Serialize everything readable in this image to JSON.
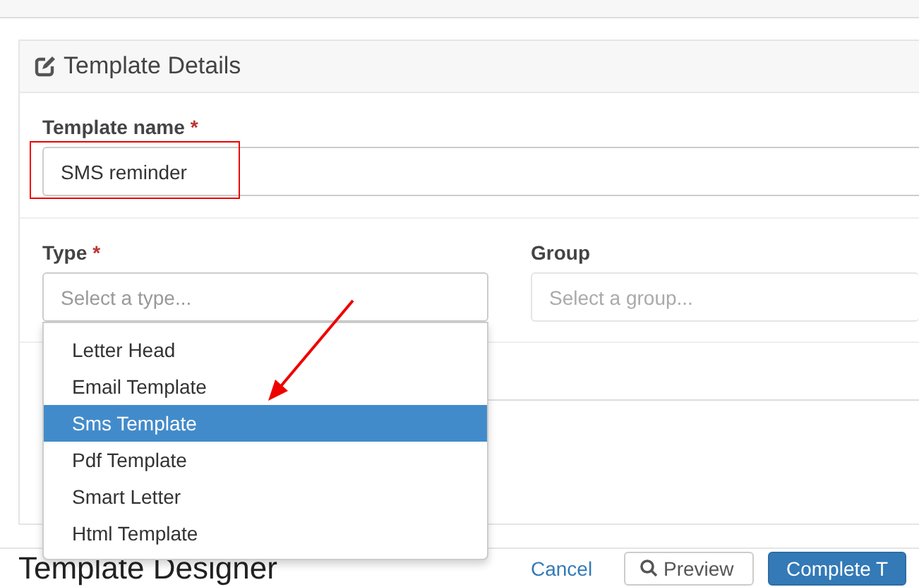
{
  "panel": {
    "title": "Template Details"
  },
  "fields": [
    {
      "label": "Template name",
      "required_mark": "*",
      "value": "SMS reminder",
      "highlighted": true
    }
  ],
  "type_field": {
    "label": "Type",
    "required_mark": "*",
    "placeholder": "Select a type...",
    "open": true,
    "options": [
      {
        "label": "Letter Head",
        "selected": false
      },
      {
        "label": "Email Template",
        "selected": false
      },
      {
        "label": "Sms Template",
        "selected": true
      },
      {
        "label": "Pdf Template",
        "selected": false
      },
      {
        "label": "Smart Letter",
        "selected": false
      },
      {
        "label": "Html Template",
        "selected": false
      }
    ]
  },
  "group_field": {
    "label": "Group",
    "placeholder": "Select a group..."
  },
  "footer": {
    "title": "Template Designer",
    "cancel": "Cancel",
    "preview": "Preview",
    "complete": "Complete T"
  }
}
